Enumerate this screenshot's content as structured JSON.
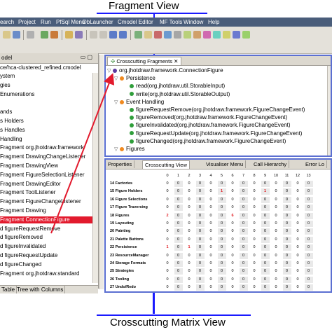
{
  "captions": {
    "top": "Fragment View",
    "bottom": "Crosscutting Matrix View"
  },
  "colors": {
    "annotation_line": "#1a1aff",
    "arrow": "#e21a2d",
    "pane_border": "#5b6fd1",
    "selection": "#e21a2d"
  },
  "menubar": [
    "earch",
    "Project",
    "Run",
    "PfSql Menu",
    "DbLauncher",
    "Cmodel Editor",
    "MF Tools",
    "Window",
    "Help"
  ],
  "left_pane": {
    "tab": "odel",
    "path": "ce/hca-clustered_refined.cmodel",
    "items": [
      "ystem",
      "gies",
      "Enumerations",
      "",
      "ands",
      "s Holders",
      "s Handles",
      "Handling",
      "Fragment org.jhotdraw.framework",
      "Fragment DrawingChangeListener",
      "Fragment DrawingView",
      "Fragment FigureSelectionListener",
      "Fragment DrawingEditor",
      "Fragment ToolListener",
      "Fragment FigureChangeListener",
      "Fragment Drawing",
      "Fragment ConnectionFigure",
      "d figureRequestRemove",
      "d figureRemoved",
      "d figureInvalidated",
      "d figureRequestUpdate",
      "d figureChanged",
      "Fragment org.jhotdraw.standard"
    ],
    "selected_index": 16,
    "bottom_tabs": [
      "Table",
      "Tree with Columns"
    ]
  },
  "fragment_view": {
    "tab": "Crosscutting Fragments",
    "root": "org.jhotdraw.framework.ConnectionFigure",
    "groups": [
      {
        "name": "Persistence",
        "items": [
          "read(org.jhotdraw.util.StorableInput)",
          "write(org.jhotdraw.util.StorableOutput)"
        ]
      },
      {
        "name": "Event Handling",
        "items": [
          "figureRequestRemove(org.jhotdraw.framework.FigureChangeEvent)",
          "figureRemoved(org.jhotdraw.framework.FigureChangeEvent)",
          "figureInvalidated(org.jhotdraw.framework.FigureChangeEvent)",
          "figureRequestUpdate(org.jhotdraw.framework.FigureChangeEvent)",
          "figureChanged(org.jhotdraw.framework.FigureChangeEvent)"
        ]
      },
      {
        "name": "Figures",
        "items": []
      }
    ]
  },
  "matrix_view": {
    "tabs": [
      "Properties",
      "Crosscutting View",
      "Visualiser Menu",
      "Call Hierarchy",
      "Error Lo"
    ],
    "active_tab": 1,
    "columns": [
      "0",
      "1",
      "2",
      "3",
      "4",
      "5",
      "6",
      "7",
      "8",
      "9",
      "10",
      "11",
      "12",
      "13"
    ],
    "rows": [
      {
        "label": "14 Factories",
        "cells": [
          "0",
          "0",
          "0",
          "0",
          "0",
          "0",
          "0",
          "0",
          "0",
          "0",
          "0",
          "0",
          "0",
          "0"
        ]
      },
      {
        "label": "15 Figure Holders",
        "cells": [
          "0",
          "0",
          "0",
          "0",
          "0",
          "1",
          "0",
          "0",
          "0",
          "1",
          "0",
          "0",
          "0",
          "0"
        ]
      },
      {
        "label": "16 Figure Selections",
        "cells": [
          "0",
          "0",
          "0",
          "0",
          "0",
          "0",
          "0",
          "0",
          "0",
          "0",
          "0",
          "0",
          "0",
          "0"
        ]
      },
      {
        "label": "17 Figure Traversing",
        "cells": [
          "0",
          "0",
          "0",
          "0",
          "0",
          "0",
          "0",
          "0",
          "0",
          "0",
          "0",
          "0",
          "0",
          "0"
        ]
      },
      {
        "label": "18 Figures",
        "cells": [
          "2",
          "0",
          "0",
          "0",
          "0",
          "0",
          "6",
          "0",
          "0",
          "0",
          "0",
          "0",
          "0",
          "0"
        ]
      },
      {
        "label": "19 Layouting",
        "cells": [
          "0",
          "0",
          "0",
          "0",
          "0",
          "0",
          "0",
          "0",
          "0",
          "0",
          "0",
          "0",
          "0",
          "0"
        ]
      },
      {
        "label": "20 Painting",
        "cells": [
          "0",
          "0",
          "0",
          "0",
          "0",
          "0",
          "0",
          "0",
          "0",
          "0",
          "0",
          "0",
          "0",
          "0"
        ]
      },
      {
        "label": "21 Palette Buttons",
        "cells": [
          "0",
          "0",
          "0",
          "0",
          "0",
          "0",
          "0",
          "0",
          "0",
          "0",
          "0",
          "0",
          "0",
          "0"
        ]
      },
      {
        "label": "22 Persistence",
        "cells": [
          "1",
          "0",
          "1",
          "0",
          "0",
          "0",
          "0",
          "0",
          "0",
          "0",
          "0",
          "0",
          "0",
          "0"
        ]
      },
      {
        "label": "23 ResourceManager",
        "cells": [
          "0",
          "0",
          "0",
          "0",
          "0",
          "0",
          "0",
          "0",
          "0",
          "0",
          "0",
          "0",
          "0",
          "0"
        ]
      },
      {
        "label": "24 Storage Formats",
        "cells": [
          "0",
          "0",
          "0",
          "0",
          "0",
          "0",
          "0",
          "0",
          "0",
          "0",
          "0",
          "0",
          "0",
          "0"
        ]
      },
      {
        "label": "25 Strategies",
        "cells": [
          "0",
          "0",
          "0",
          "0",
          "0",
          "0",
          "0",
          "0",
          "0",
          "0",
          "0",
          "0",
          "0",
          "0"
        ]
      },
      {
        "label": "26 Tooling",
        "cells": [
          "0",
          "0",
          "0",
          "0",
          "0",
          "0",
          "0",
          "0",
          "0",
          "0",
          "0",
          "0",
          "0",
          "0"
        ]
      },
      {
        "label": "27 Undo/Redo",
        "cells": [
          "0",
          "0",
          "0",
          "0",
          "0",
          "0",
          "0",
          "0",
          "0",
          "0",
          "0",
          "0",
          "0",
          "0"
        ]
      }
    ],
    "highlighted_values": [
      "1",
      "2",
      "6"
    ]
  }
}
